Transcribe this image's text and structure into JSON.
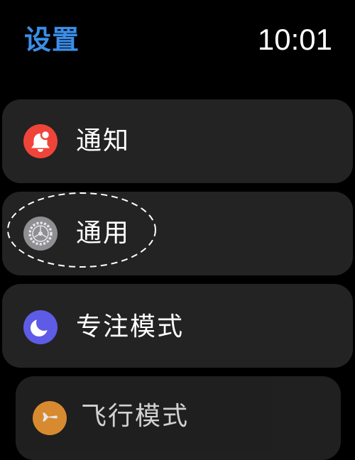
{
  "header": {
    "title": "设置",
    "time": "10:01"
  },
  "colors": {
    "title_accent": "#3b8ee8",
    "background": "#000000",
    "row_background": "#232323",
    "notifications_icon_bg": "#f0443a",
    "general_icon_bg": "#8e8e93",
    "focus_icon_bg": "#5e5ce6",
    "airplane_icon_bg": "#f09a37"
  },
  "settings": {
    "items": [
      {
        "label": "通知",
        "icon": "bell-icon"
      },
      {
        "label": "通用",
        "icon": "gear-icon"
      },
      {
        "label": "专注模式",
        "icon": "moon-icon"
      },
      {
        "label": "飞行模式",
        "icon": "airplane-icon"
      }
    ]
  }
}
